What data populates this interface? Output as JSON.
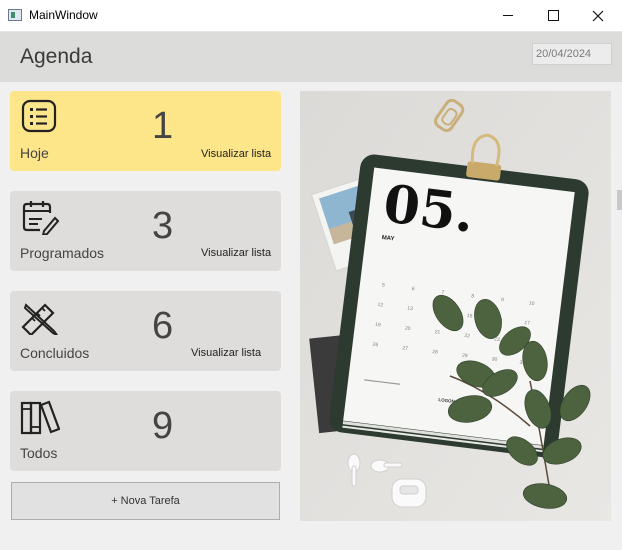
{
  "window": {
    "title": "MainWindow"
  },
  "header": {
    "title": "Agenda",
    "date": "20/04/2024"
  },
  "cards": [
    {
      "label": "Hoje",
      "count": "1",
      "link": "Visualizar lista"
    },
    {
      "label": "Programados",
      "count": "3",
      "link": "Visualizar lista"
    },
    {
      "label": "Concluidos",
      "count": "6",
      "link": "Visualizar lista"
    },
    {
      "label": "Todos",
      "count": "9"
    }
  ],
  "new_task_label": "+ Nova Tarefa",
  "calendar_photo": {
    "day": "05.",
    "month": "MAY",
    "logo": "LOGONAME"
  },
  "colors": {
    "today_card": "#fde589",
    "card": "#dedddb",
    "header": "#dcdcda",
    "clipboard": "#2c3a30"
  },
  "icons": [
    "list-icon",
    "calendar-pen-icon",
    "ruler-pencil-icon",
    "books-icon"
  ]
}
